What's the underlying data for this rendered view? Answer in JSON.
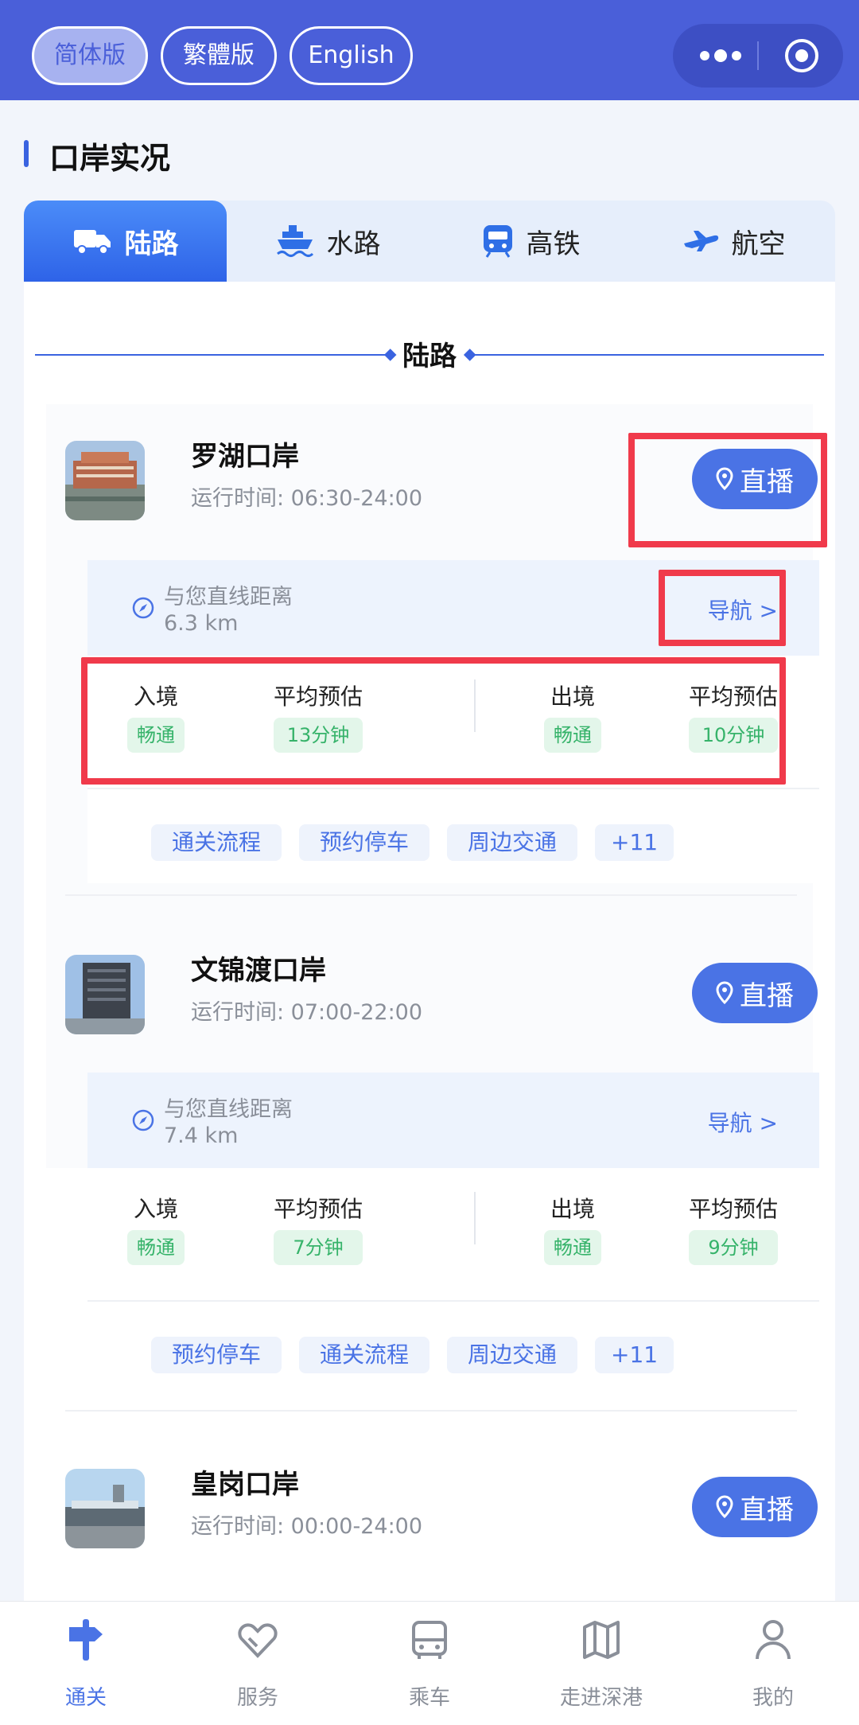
{
  "header": {
    "lang_simplified": "简体版",
    "lang_traditional": "繁體版",
    "lang_english": "English"
  },
  "section": {
    "title": "口岸实况"
  },
  "tabs": [
    {
      "label": "陆路",
      "icon": "truck-icon",
      "active": true
    },
    {
      "label": "水路",
      "icon": "ship-icon",
      "active": false
    },
    {
      "label": "高铁",
      "icon": "train-icon",
      "active": false
    },
    {
      "label": "航空",
      "icon": "plane-icon",
      "active": false
    }
  ],
  "subheading": "陆路",
  "ports": [
    {
      "name": "罗湖口岸",
      "hours": "运行时间: 06:30-24:00",
      "live_label": "直播",
      "distance_label": "与您直线距离",
      "distance": "6.3 km",
      "nav_label": "导航 >",
      "entry_label": "入境",
      "entry_status": "畅通",
      "entry_avg_label": "平均预估",
      "entry_avg": "13分钟",
      "exit_label": "出境",
      "exit_status": "畅通",
      "exit_avg_label": "平均预估",
      "exit_avg": "10分钟",
      "tags": [
        "通关流程",
        "预约停车",
        "周边交通",
        "+11"
      ]
    },
    {
      "name": "文锦渡口岸",
      "hours": "运行时间: 07:00-22:00",
      "live_label": "直播",
      "distance_label": "与您直线距离",
      "distance": "7.4 km",
      "nav_label": "导航 >",
      "entry_label": "入境",
      "entry_status": "畅通",
      "entry_avg_label": "平均预估",
      "entry_avg": "7分钟",
      "exit_label": "出境",
      "exit_status": "畅通",
      "exit_avg_label": "平均预估",
      "exit_avg": "9分钟",
      "tags": [
        "预约停车",
        "通关流程",
        "周边交通",
        "+11"
      ]
    },
    {
      "name": "皇岗口岸",
      "hours": "运行时间: 00:00-24:00",
      "live_label": "直播"
    }
  ],
  "bottom_nav": [
    {
      "label": "通关",
      "icon": "signpost-icon",
      "active": true
    },
    {
      "label": "服务",
      "icon": "heart-hands-icon",
      "active": false
    },
    {
      "label": "乘车",
      "icon": "bus-icon",
      "active": false
    },
    {
      "label": "走进深港",
      "icon": "map-icon",
      "active": false
    },
    {
      "label": "我的",
      "icon": "person-icon",
      "active": false
    }
  ],
  "colors": {
    "header": "#4a5fd9",
    "accent": "#4a73e5",
    "status_green": "#36b36a",
    "annotation_red": "#f03a4b"
  }
}
